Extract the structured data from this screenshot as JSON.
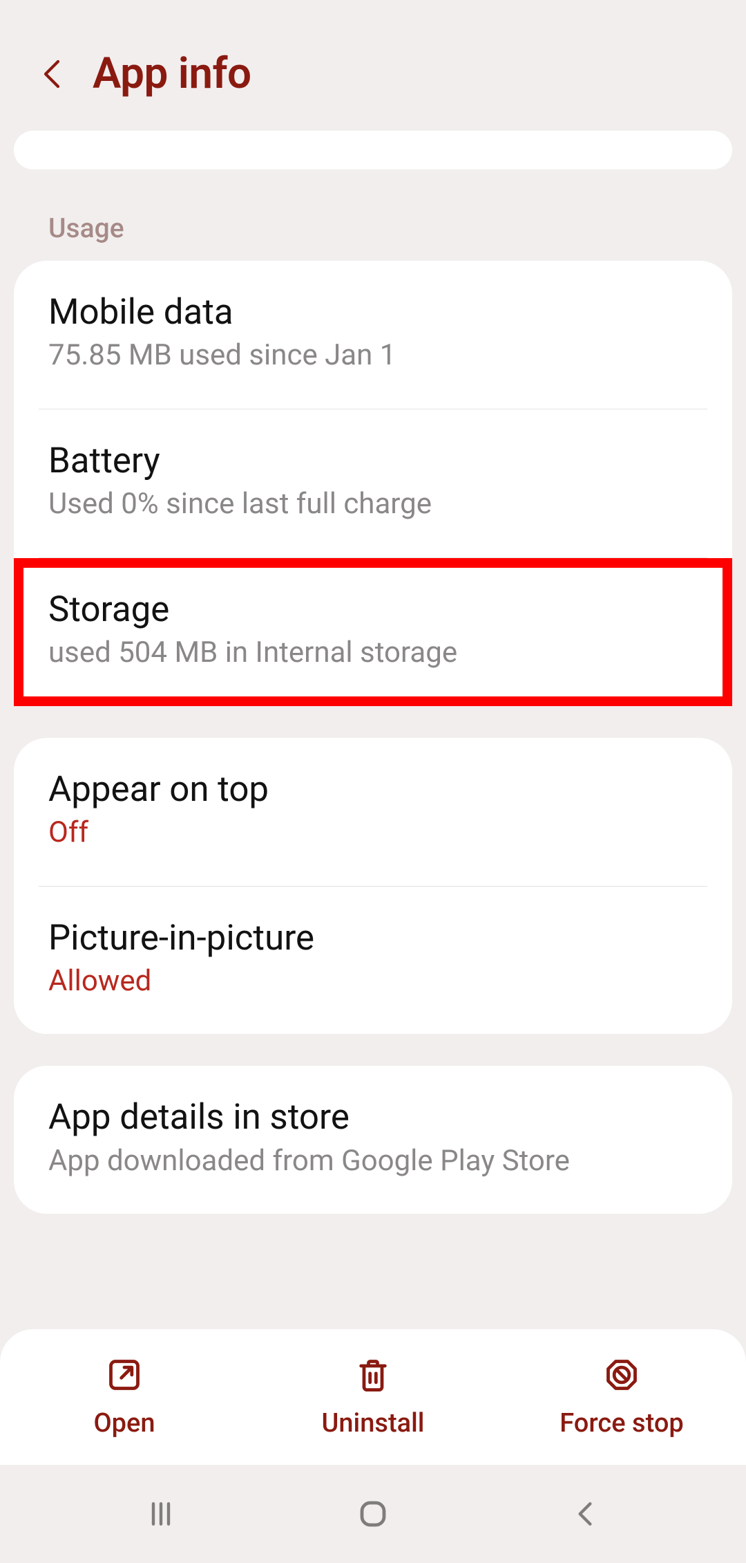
{
  "header": {
    "title": "App info"
  },
  "section_label": "Usage",
  "usage": {
    "items": [
      {
        "title": "Mobile data",
        "subtitle": "75.85 MB used since Jan 1"
      },
      {
        "title": "Battery",
        "subtitle": "Used 0% since last full charge"
      },
      {
        "title": "Storage",
        "subtitle": "used 504 MB in Internal storage"
      }
    ]
  },
  "display_modes": {
    "items": [
      {
        "title": "Appear on top",
        "subtitle": "Off"
      },
      {
        "title": "Picture-in-picture",
        "subtitle": "Allowed"
      }
    ]
  },
  "store": {
    "title": "App details in store",
    "subtitle": "App downloaded from Google Play Store"
  },
  "actions": {
    "open": "Open",
    "uninstall": "Uninstall",
    "force_stop": "Force stop"
  }
}
